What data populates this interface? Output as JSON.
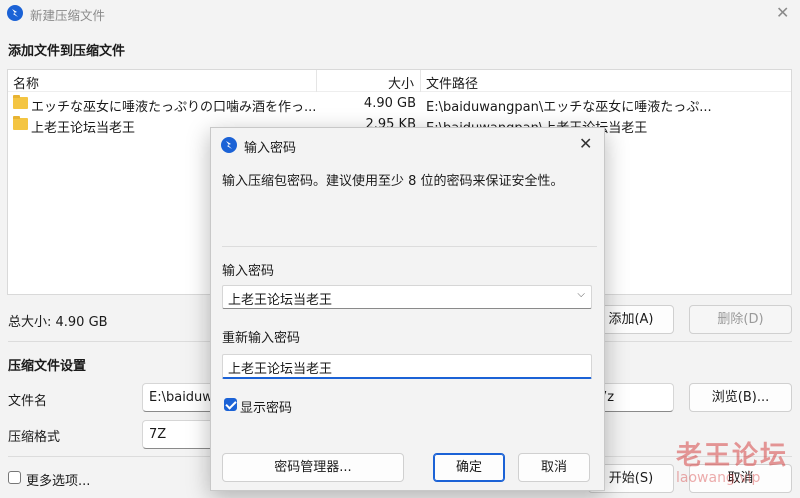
{
  "window": {
    "title": "新建压缩文件"
  },
  "add_section": {
    "title": "添加文件到压缩文件"
  },
  "file_list": {
    "columns": {
      "name": "名称",
      "size": "大小",
      "path": "文件路径"
    },
    "rows": [
      {
        "name": "エッチな巫女に唾液たっぷりの口噛み酒を作っ...",
        "size": "4.90 GB",
        "path": "E:\\baiduwangpan\\エッチな巫女に唾液たっぷ..."
      },
      {
        "name": "上老王论坛当老王",
        "size": "2.95 KB",
        "path": "E:\\baiduwangpan\\上老王论坛当老王"
      }
    ]
  },
  "total": {
    "text": "总大小: 4.90 GB"
  },
  "buttons": {
    "add": "添加(A)",
    "delete": "删除(D)",
    "browse": "浏览(B)...",
    "start": "开始(S)",
    "cancel": "取消"
  },
  "settings": {
    "title": "压缩文件设置",
    "filename_label": "文件名",
    "filename_value": "E:\\baiduwa",
    "filename_ext": "7z",
    "format_label": "压缩格式",
    "format_value": "7Z"
  },
  "more_options": {
    "label": "更多选项..."
  },
  "dialog": {
    "title": "输入密码",
    "message": "输入压缩包密码。建议使用至少 8 位的密码来保证安全性。",
    "password_label": "输入密码",
    "password_value": "上老王论坛当老王",
    "reenter_label": "重新输入密码",
    "reenter_value": "上老王论坛当老王",
    "show_password": "显示密码",
    "manager_button": "密码管理器...",
    "ok_button": "确定",
    "cancel_button": "取消"
  },
  "watermark": {
    "text": "老王论坛",
    "sub": "laowang.vip"
  },
  "colors": {
    "accent": "#1b62d6",
    "folder": "#f4c542",
    "watermark": "#d64646"
  }
}
